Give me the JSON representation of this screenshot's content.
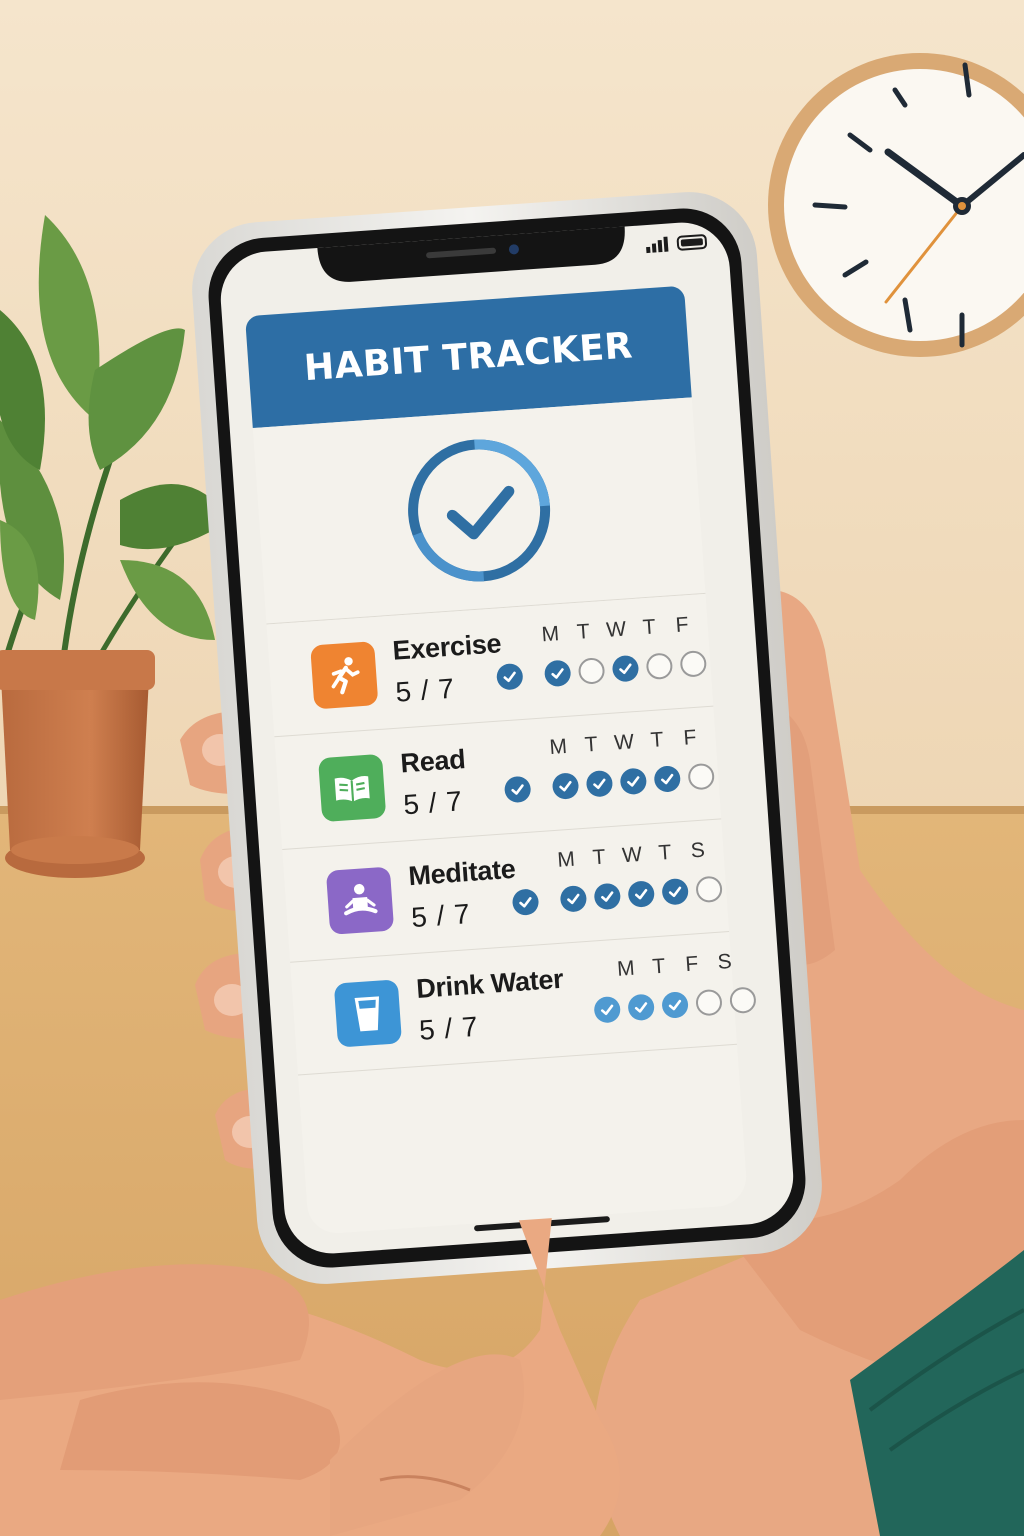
{
  "app": {
    "title": "HABIT TRACKER",
    "header_color": "#2d6ea5",
    "summary_icon": "progress-check-ring-icon"
  },
  "status_bar": {
    "signal_icon": "cellular-signal-icon",
    "battery_icon": "battery-icon"
  },
  "habits": [
    {
      "name": "Exercise",
      "progress": "5 / 7",
      "icon": "running-person-icon",
      "icon_color": "#ef8431",
      "day_labels": [
        "M",
        "T",
        "W",
        "T",
        "F"
      ],
      "checks": [
        "done",
        "done",
        "empty",
        "done",
        "empty",
        "empty"
      ]
    },
    {
      "name": "Read",
      "progress": "5 / 7",
      "icon": "open-book-icon",
      "icon_color": "#4fae5b",
      "day_labels": [
        "M",
        "T",
        "W",
        "T",
        "F"
      ],
      "checks": [
        "done",
        "done",
        "done",
        "done",
        "done",
        "empty"
      ]
    },
    {
      "name": "Meditate",
      "progress": "5 / 7",
      "icon": "meditating-person-icon",
      "icon_color": "#8b68c7",
      "day_labels": [
        "M",
        "T",
        "W",
        "T",
        "S"
      ],
      "checks": [
        "done",
        "done",
        "done",
        "done",
        "done",
        "empty"
      ]
    },
    {
      "name": "Drink Water",
      "progress": "5 / 7",
      "icon": "water-glass-icon",
      "icon_color": "#3d95d6",
      "day_labels": [
        "M",
        "T",
        "F",
        "S"
      ],
      "checks": [
        "light",
        "light",
        "light",
        "empty",
        "empty"
      ]
    }
  ]
}
